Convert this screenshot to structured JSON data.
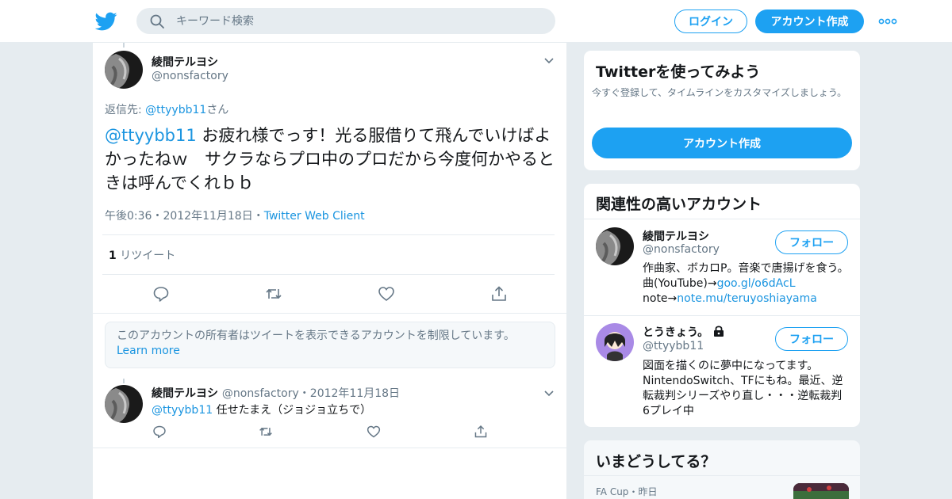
{
  "header": {
    "search_placeholder": "キーワード検索",
    "login_label": "ログイン",
    "signup_label": "アカウント作成",
    "brand_color": "#1da1f2"
  },
  "main_tweet": {
    "name": "綾間テルヨシ",
    "handle": "@nonsfactory",
    "reply_prefix": "返信先: ",
    "reply_handle": "@ttyybb11",
    "reply_suffix": "さん",
    "mention": "@ttyybb11",
    "text": " お疲れ様でっす！光る服借りて飛んでいけばよかったねｗ　サクラならプロ中のプロだから今度何かやるときは呼んでくれｂｂ",
    "time": "午後0:36",
    "dot1": "・",
    "date": "2012年11月18日",
    "dot2": "・",
    "client": "Twitter Web Client",
    "retweet_count": "1",
    "retweet_label": "リツイート"
  },
  "notice": {
    "text": "このアカウントの所有者はツイートを表示できるアカウントを制限しています。",
    "link": "Learn more"
  },
  "reply_tweet": {
    "name": "綾間テルヨシ",
    "handle": "@nonsfactory",
    "dot": "・",
    "date": "2012年11月18日",
    "mention": "@ttyybb11",
    "text": " 任せたまえ（ジョジョ立ちで）"
  },
  "signup_card": {
    "title": "Twitterを使ってみよう",
    "desc": "今すぐ登録して、タイムラインをカスタマイズしましょう。",
    "button": "アカウント作成"
  },
  "related": {
    "title": "関連性の高いアカウント",
    "accounts": [
      {
        "name": "綾間テルヨシ",
        "handle": "@nonsfactory",
        "follow": "フォロー",
        "bio_1": "作曲家、ボカロP。音楽で唐揚げを食う。曲(YouTube)→",
        "bio_link1": "goo.gl/o6dAcL",
        "bio_2": "note→",
        "bio_link2": "note.mu/teruyoshiayama"
      },
      {
        "name": "とうきょう。",
        "handle": "@ttyybb11",
        "follow": "フォロー",
        "bio_1": "図面を描くのに夢中になってます。NintendoSwitch、TFにもね。最近、逆転裁判シリーズやり直し・・・逆転裁判6プレイ中"
      }
    ]
  },
  "trends": {
    "title": "いまどうしてる？",
    "item_category": "FA Cup",
    "item_dot": "・",
    "item_time": "昨日"
  }
}
